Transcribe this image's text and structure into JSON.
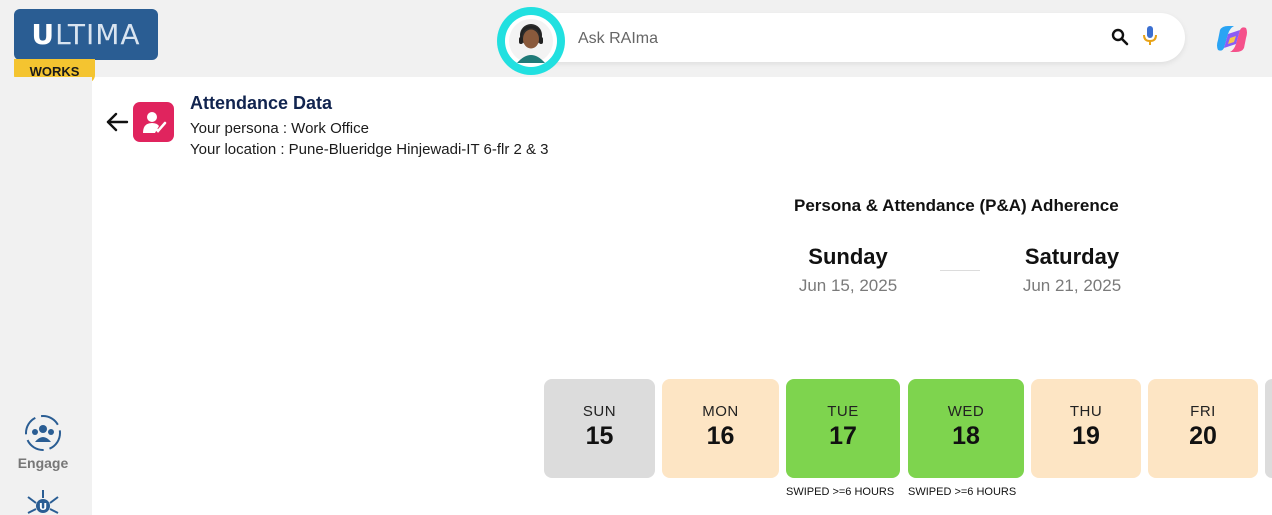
{
  "brand": {
    "logo_text": "LTIMA",
    "logo_letter": "U",
    "works_badge": "WORKS"
  },
  "search": {
    "placeholder": "Ask RAIma",
    "search_icon": "search-icon",
    "mic_icon": "mic-icon"
  },
  "sidebar": {
    "items": [
      {
        "label": "Engage",
        "icon": "engage-icon"
      },
      {
        "label": "",
        "icon": "network-icon"
      }
    ]
  },
  "header": {
    "title": "Attendance Data",
    "persona": "Your persona : Work Office",
    "location": "Your location : Pune-Blueridge Hinjewadi-IT 6-flr 2 & 3"
  },
  "adherence": {
    "title": "Persona & Attendance (P&A) Adherence",
    "start": {
      "day": "Sunday",
      "date": "Jun 15, 2025"
    },
    "end": {
      "day": "Saturday",
      "date": "Jun 21, 2025"
    }
  },
  "days": [
    {
      "dow": "SUN",
      "num": "15",
      "status": "weekend",
      "note": ""
    },
    {
      "dow": "MON",
      "num": "16",
      "status": "absent",
      "note": ""
    },
    {
      "dow": "TUE",
      "num": "17",
      "status": "present",
      "note": "SWIPED >=6 HOURS"
    },
    {
      "dow": "WED",
      "num": "18",
      "status": "present",
      "note": "SWIPED >=6 HOURS"
    },
    {
      "dow": "THU",
      "num": "19",
      "status": "absent",
      "note": ""
    },
    {
      "dow": "FRI",
      "num": "20",
      "status": "absent",
      "note": ""
    }
  ],
  "colors": {
    "accent": "#2a5d93",
    "weekend": "#dcdcdc",
    "absent": "#fde5c4",
    "present": "#7ed44e",
    "app_icon": "#e0245e",
    "avatar_ring": "#21e0e0"
  }
}
